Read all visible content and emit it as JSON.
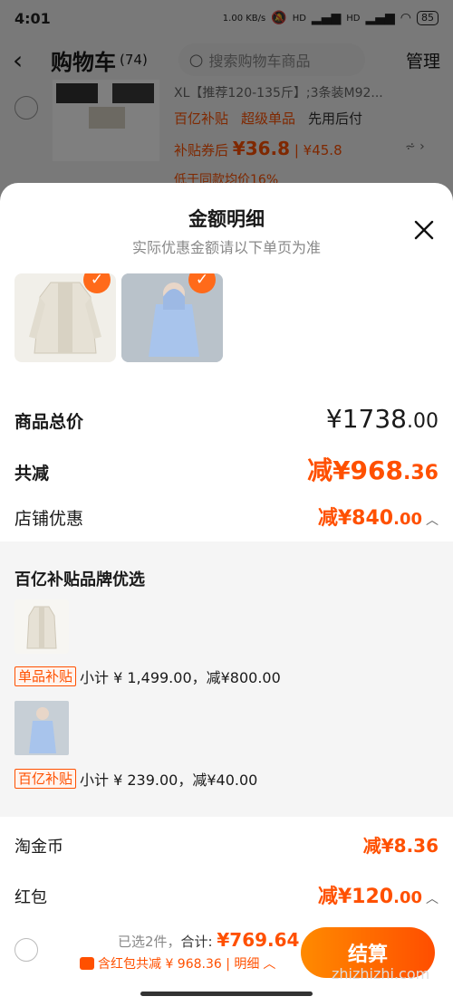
{
  "status_bar": {
    "time": "4:01",
    "net_speed": "1.00 KB/s",
    "signal1": "HD",
    "signal2": "HD",
    "battery": "85"
  },
  "cart_header": {
    "title": "购物车",
    "count": "(74)",
    "search_placeholder": "搜索购物车商品",
    "manage": "管理"
  },
  "background_item": {
    "title": "XL【推荐120-135斤】;3条装M92...",
    "tags": [
      "百亿补贴",
      "超级单品",
      "先用后付"
    ],
    "coupon_price_label": "补贴券后",
    "coupon_price": "¥36.8",
    "orig_price": "| ¥45.8",
    "note": "低于同款均价16%"
  },
  "sheet": {
    "title": "金额明细",
    "subtitle": "实际优惠金额请以下单页为准",
    "total_label": "商品总价",
    "total_int": "¥1738",
    "total_dec": ".00",
    "reduce_label": "共减",
    "reduce_int": "减¥968",
    "reduce_dec": ".36",
    "shop_label": "店铺优惠",
    "shop_int": "减¥840",
    "shop_dec": ".00",
    "detail": {
      "title": "百亿补贴品牌优选",
      "items": [
        {
          "tag": "单品补贴",
          "text": "小计 ¥ 1,499.00，减¥800.00"
        },
        {
          "tag": "百亿补贴",
          "text": "小计 ¥ 239.00，减¥40.00"
        }
      ]
    },
    "coin_label": "淘金币",
    "coin_value": "减¥8.36",
    "red_label": "红包",
    "red_int": "减¥120",
    "red_dec": ".00"
  },
  "bottom_bar": {
    "selected": "已选2件，",
    "total_label": "合计: ",
    "total_amount": "¥769.64",
    "redpacket_text": "含红包共减 ¥ 968.36 | 明细",
    "checkout": "结算"
  },
  "watermark": "zhizhizhi.com",
  "colors": {
    "accent": "#ff5000",
    "checkout_start": "#ff8a00",
    "checkout_end": "#ff4e00"
  }
}
